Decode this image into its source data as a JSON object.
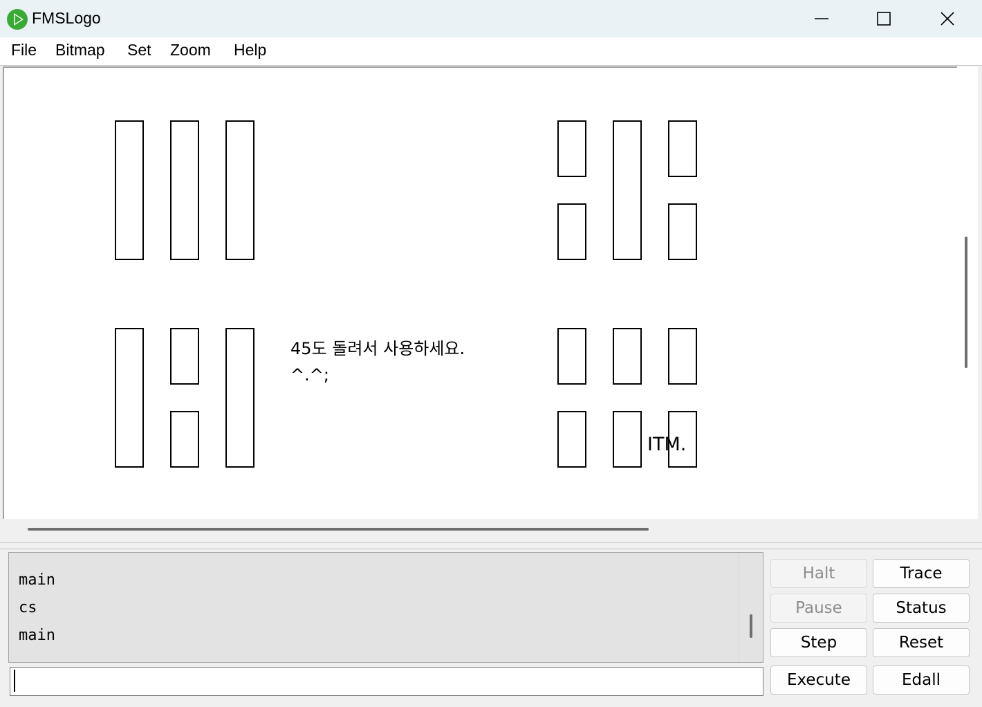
{
  "window": {
    "title": "FMSLogo",
    "controls": [
      "minimize-icon",
      "maximize-icon",
      "close-icon"
    ]
  },
  "menu": {
    "items": [
      "File",
      "Bitmap",
      "Set",
      "Zoom",
      "Help"
    ]
  },
  "canvas": {
    "text_line1": "45도 돌려서 사용하세요.",
    "text_line2": "^.^;",
    "signature": "ITM."
  },
  "commander": {
    "history": [
      "main",
      "cs",
      "main"
    ],
    "input_value": "",
    "buttons": {
      "halt": "Halt",
      "trace": "Trace",
      "pause": "Pause",
      "status": "Status",
      "step": "Step",
      "reset": "Reset",
      "execute": "Execute",
      "edall": "Edall"
    },
    "disabled_buttons": [
      "Halt",
      "Pause"
    ]
  },
  "colors": {
    "titlebar": "#eaf2f6",
    "icon_green": "#3aa935",
    "canvas_bg": "#ffffff",
    "history_bg": "#e3e3e3"
  }
}
